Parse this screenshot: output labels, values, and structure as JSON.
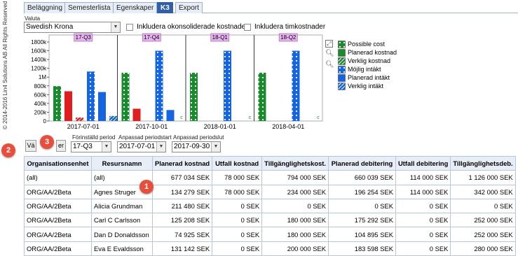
{
  "tabs": [
    "Beläggning",
    "Semesterlista",
    "Egenskaper",
    "K3",
    "Export"
  ],
  "active_tab": "K3",
  "copyright": "© 2014-2016 Lin4 Solutions AB All Rights Reserved",
  "currency": {
    "label": "Valuta",
    "value": "Swedish Krona"
  },
  "checkboxes": {
    "unconsolidated": "Inkludera okonsoliderade kostnader",
    "hourly": "Inkludera timkostnader"
  },
  "chart_data": {
    "type": "bar",
    "categories": [
      "2017-07-01",
      "2017-10-01",
      "2018-01-01",
      "2018-04-01"
    ],
    "period_labels": [
      "17-Q3",
      "17-Q4",
      "18-Q1",
      "18-Q2"
    ],
    "y_ticks": [
      "0",
      "200k",
      "400k",
      "600k",
      "800k",
      "1M",
      "1200k",
      "1400k",
      "1600k",
      "1800k"
    ],
    "ylim": [
      0,
      1800000
    ],
    "series": [
      {
        "name": "Possible cost",
        "values": [
          794000,
          1100000,
          1100000,
          1100000
        ]
      },
      {
        "name": "Planerad kostnad",
        "values": [
          677000,
          280000,
          0,
          0
        ]
      },
      {
        "name": "Verklig kostnad",
        "values": [
          78000,
          0,
          0,
          0
        ]
      },
      {
        "name": "Möjlig intäkt",
        "values": [
          1126000,
          1600000,
          1600000,
          1600000
        ]
      },
      {
        "name": "Planerad intäkt",
        "values": [
          660000,
          250000,
          0,
          0
        ]
      },
      {
        "name": "Verklig intäkt",
        "values": [
          114000,
          0,
          0,
          0
        ]
      }
    ],
    "marker_label": "c",
    "grid": false,
    "legend": "right"
  },
  "colors": {
    "possible_cost": "#1a8a2e",
    "planned_cost": "#e11d1d",
    "actual_cost": "#e11d1d",
    "possible_income": "#1565e0",
    "planned_income": "#1565e0",
    "actual_income": "#1565e0",
    "badge": "#e84e3c",
    "period_tag": "#e6b3ef",
    "active_tab": "#2f5fa8"
  },
  "controls": {
    "button_left": "Vä",
    "button_right": "er",
    "preset": {
      "label": "Förinställd period",
      "value": "17-Q3"
    },
    "start": {
      "label": "Anpassad periodstart",
      "value": "2017-07-01"
    },
    "end": {
      "label": "Anpassad periodslut",
      "value": "2017-09-30"
    }
  },
  "chart_icons": [
    "expand-icon",
    "zoom-in-icon",
    "zoom-out-icon"
  ],
  "badges": [
    "1",
    "2",
    "3"
  ],
  "table": {
    "headers": [
      "Organisationsenhet",
      "Resursnamn",
      "Planerad kostnad",
      "Utfall kostnad",
      "Tillgänglighetskost.",
      "Planerad debitering",
      "Utfall debitering",
      "Tillgänglighetsdeb."
    ],
    "rows": [
      [
        "(all)",
        "(all)",
        "677 034 SEK",
        "78 000 SEK",
        "794 000 SEK",
        "660 039 SEK",
        "114 000 SEK",
        "1 126 000 SEK"
      ],
      [
        "ORG/AA/2Beta",
        "Agnes Struger",
        "134 279 SEK",
        "78 000 SEK",
        "234 000 SEK",
        "196 254 SEK",
        "114 000 SEK",
        "342 000 SEK"
      ],
      [
        "ORG/AA/2Beta",
        "Alicia Grundman",
        "211 480 SEK",
        "0 SEK",
        "0 SEK",
        "0 SEK",
        "0 SEK",
        "0 SEK"
      ],
      [
        "ORG/AA/2Beta",
        "Carl C Carlsson",
        "125 208 SEK",
        "0 SEK",
        "180 000 SEK",
        "175 292 SEK",
        "0 SEK",
        "252 000 SEK"
      ],
      [
        "ORG/AA/2Beta",
        "Dan D Donaldsson",
        "74 925 SEK",
        "0 SEK",
        "180 000 SEK",
        "104 895 SEK",
        "0 SEK",
        "252 000 SEK"
      ],
      [
        "ORG/AA/2Beta",
        "Eva E Evaldsson",
        "131 142 SEK",
        "0 SEK",
        "200 000 SEK",
        "183 598 SEK",
        "0 SEK",
        "280 000 SEK"
      ]
    ]
  }
}
